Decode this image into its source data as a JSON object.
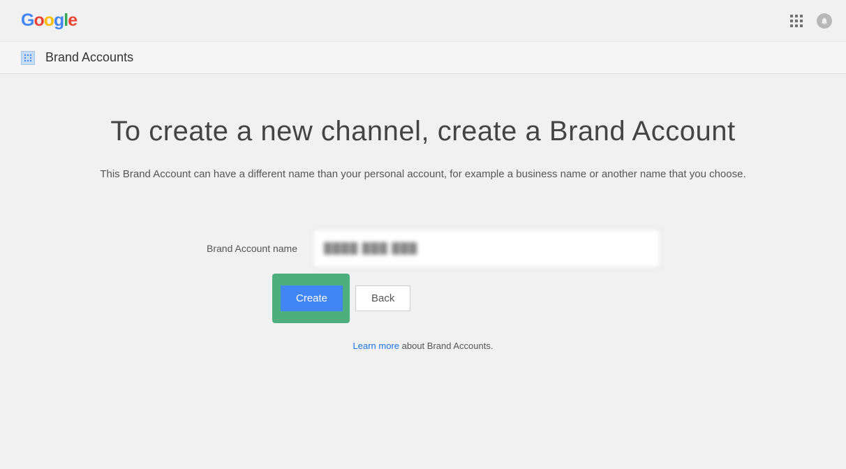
{
  "header": {
    "logo_letters": [
      "G",
      "o",
      "o",
      "g",
      "l",
      "e"
    ]
  },
  "subheader": {
    "title": "Brand Accounts"
  },
  "main": {
    "heading": "To create a new channel, create a Brand Account",
    "subtext": "This Brand Account can have a different name than your personal account, for example a business name or another name that you choose.",
    "form_label": "Brand Account name",
    "input_value": "████ ███ ███",
    "create_button": "Create",
    "back_button": "Back",
    "learn_more": "Learn more",
    "learn_more_suffix": " about Brand Accounts."
  }
}
